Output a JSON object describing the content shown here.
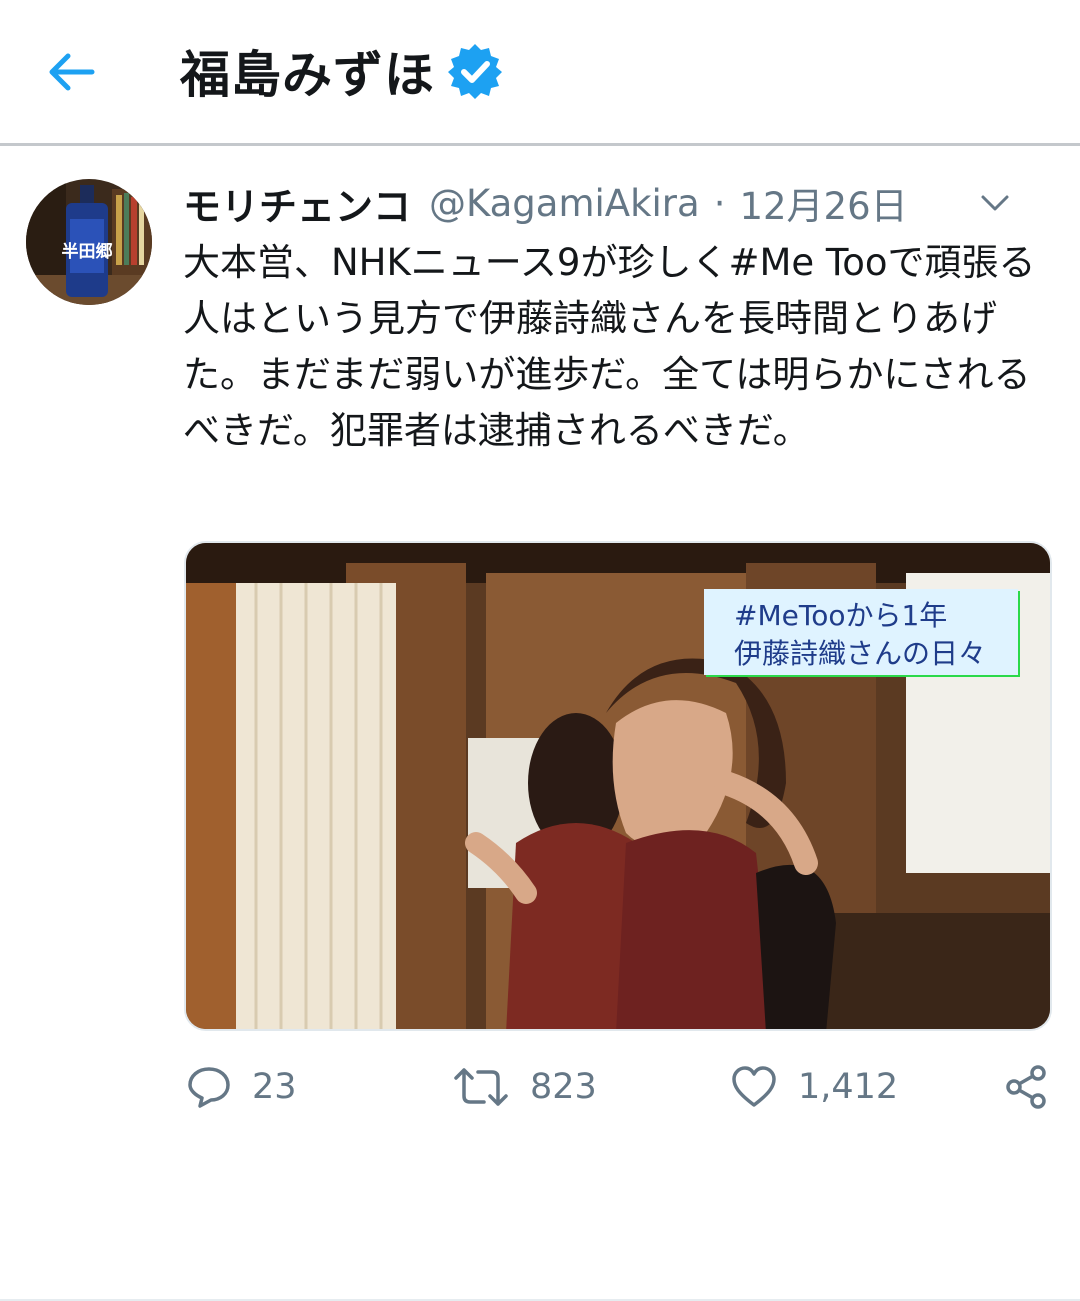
{
  "header": {
    "title": "福島みずほ",
    "accent_color": "#1da1f2",
    "back_icon": "arrow-left-icon",
    "verified_icon": "verified-badge-icon"
  },
  "tweet": {
    "display_name": "モリチェンコ",
    "handle": "@KagamiAkira",
    "separator": "·",
    "date": "12月26日",
    "text": "大本営、NHKニュース9が珍しく#Me Tooで頑張る人はという見方で伊藤詩織さんを長時間とりあげた。まだまだ弱いが進歩だ。全ては明らかにされるべきだ。犯罪者は逮捕されるべきだ。",
    "media": {
      "caption_line1": "#MeTooから1年",
      "caption_line2": "伊藤詩織さんの日々"
    },
    "avatar_label": "半田郷",
    "actions": {
      "reply_count": "23",
      "retweet_count": "823",
      "like_count": "1,412"
    }
  }
}
